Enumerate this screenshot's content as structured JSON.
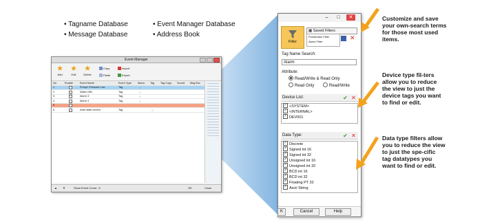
{
  "bullets_left": [
    "Tagname Database",
    "Message Database"
  ],
  "bullets_right": [
    "Event Manager Database",
    "Address Book"
  ],
  "main_window": {
    "title": "Event Manager",
    "toolbar": {
      "add": "Add",
      "edit": "Edit",
      "delete": "Delete",
      "copy": "Copy",
      "paste": "Paste",
      "import": "Import",
      "export": "Export"
    },
    "columns": [
      "No.",
      "Enable",
      "Event Name",
      "Event Type",
      "Alarm",
      "Tag",
      "Tag Copy",
      "Sound",
      "Msg Box"
    ],
    "rows": [
      {
        "no": "1",
        "name": "Pump1 Pressure Low",
        "type": "Tag",
        "alarm": true,
        "tag": true
      },
      {
        "no": "2",
        "name": "Water Off1",
        "type": "Tag",
        "alarm": true,
        "tag": false
      },
      {
        "no": "3",
        "name": "Alarm 3",
        "type": "Tag",
        "alarm": true,
        "tag": false
      },
      {
        "no": "4",
        "name": "Alarm 4",
        "type": "Tag",
        "alarm": true,
        "tag": false
      },
      {
        "no": "5",
        "name": "",
        "type": "",
        "alarm": false,
        "tag": false
      },
      {
        "no": "6",
        "name": "multi state control",
        "type": "Tag",
        "alarm": false,
        "tag": true
      }
    ],
    "status": "Show Event Count : 6",
    "ok": "OK",
    "close": "Close"
  },
  "dialog": {
    "filter_label": "Filter",
    "saved_filters": "Saved Filters",
    "saved_items": [
      "Pushbutton Filter",
      "Alarm Filter"
    ],
    "tag_search_label": "Tag Name Search:",
    "tag_search_value": "Alarm",
    "attribute_label": "Attribute:",
    "attributes": [
      "Read/Write & Read Only",
      "Read Only",
      "Read/Write"
    ],
    "device_list_label": "Device List:",
    "devices": [
      "<SYSTEM>",
      "<INTERNAL>",
      "DEV001"
    ],
    "data_type_label": "Data Type:",
    "data_types": [
      "Discrete",
      "Signed int 16",
      "Signed int 32",
      "Unsigned int 16",
      "Unsigned int 32",
      "BCD int 16",
      "BCD int 32",
      "Floating PT 32",
      "Ascii String"
    ],
    "ok": "K",
    "cancel": "Cancel",
    "help": "Help"
  },
  "callouts": [
    "Customize and save your own-search terms for those most used items.",
    "Device type fil-ters allow you to reduce the view to just the device tags you want to find or edit.",
    "Data type filters allow you to reduce the view to just the spe-cific tag datatypes you want to find or edit."
  ],
  "colors": {
    "accent_orange": "#f3a21d",
    "filter_button": "#f6c659",
    "selected_row": "#a7d3f2",
    "highlight_row": "#f4a386",
    "wedge": "#9fc8ea"
  }
}
